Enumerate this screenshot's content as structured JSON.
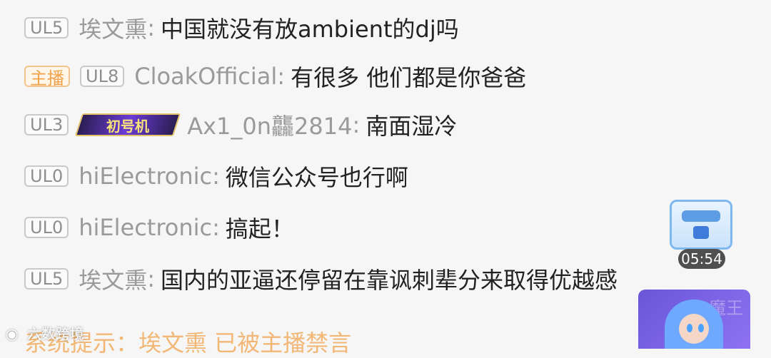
{
  "chat": {
    "rows": [
      {
        "badge": "UL5",
        "user": "埃文熏",
        "message": "中国就没有放ambient的dj吗"
      },
      {
        "host_badge": "主播",
        "badge": "UL8",
        "user": "CloakOfficial",
        "message": "有很多 他们都是你爸爸"
      },
      {
        "badge": "UL3",
        "medal": "初号机",
        "user": "Ax1_0n龘2814",
        "message": "南面湿冷"
      },
      {
        "badge": "UL0",
        "user": "hiElectronic",
        "message": "微信公众号也行啊"
      },
      {
        "badge": "UL0",
        "user": "hiElectronic",
        "message": "搞起！"
      },
      {
        "badge": "UL5",
        "user": "埃文熏",
        "message": "国内的亚逼还停留在靠讽刺辈分来取得优越感"
      }
    ],
    "system_notice": "系统提示：埃文熏 已被主播禁言"
  },
  "chest": {
    "time": "05:54",
    "icon": "treasure-chest-icon"
  },
  "watermark": {
    "text": "六数跨境",
    "icon": "weibo-icon"
  },
  "avatar": {
    "letters": "魔王"
  },
  "colors": {
    "host": "#f1a24a",
    "text": "#222222",
    "muted": "#9a9a9a"
  }
}
